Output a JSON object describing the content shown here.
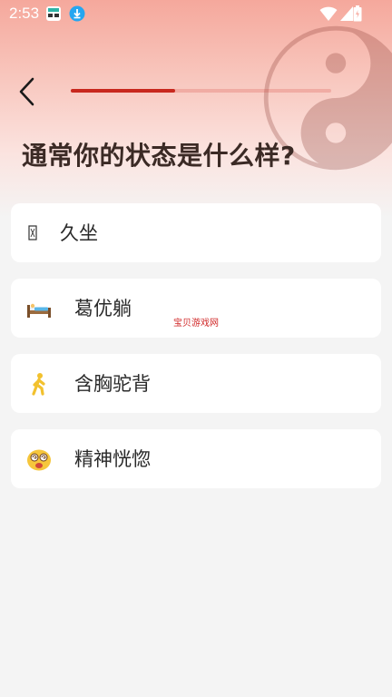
{
  "status_bar": {
    "time": "2:53",
    "icons": [
      "app-notification-icon",
      "download-icon",
      "wifi-icon",
      "signal-icon",
      "battery-icon"
    ]
  },
  "header": {
    "back_icon": "chevron-left-icon",
    "progress_fraction": 0.4
  },
  "question": {
    "title": "通常你的状态是什么样?"
  },
  "options": [
    {
      "label": "久坐",
      "icon": "missing-glyph-icon"
    },
    {
      "label": "葛优躺",
      "icon": "bed-icon"
    },
    {
      "label": "含胸驼背",
      "icon": "walking-person-icon"
    },
    {
      "label": "精神恍惚",
      "icon": "dizzy-face-icon"
    }
  ],
  "watermark": "宝贝游戏网",
  "colors": {
    "accent": "#c8281e",
    "header_gradient_top": "#f5a89c",
    "page_background": "#f4f4f4",
    "card_background": "#ffffff",
    "title_text": "#3b2a25",
    "watermark": "#d12b2b"
  }
}
